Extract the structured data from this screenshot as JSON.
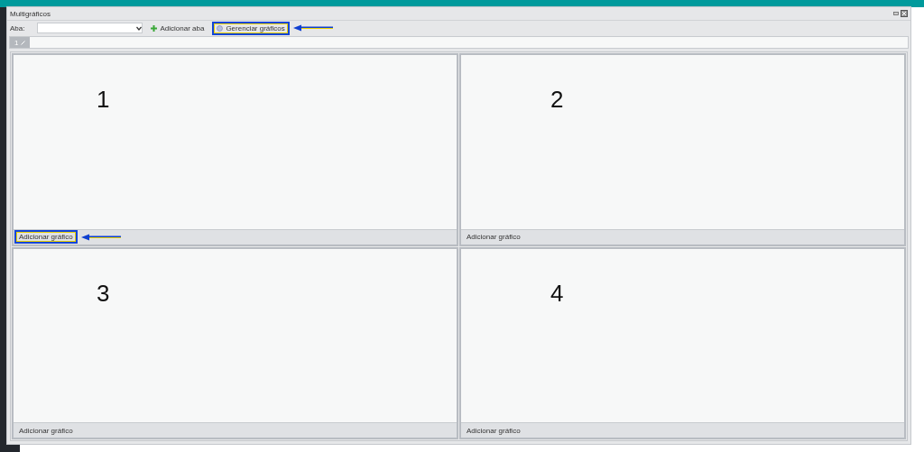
{
  "window": {
    "title": "Multigráficos"
  },
  "toolbar": {
    "tab_label": "Aba:",
    "add_tab_button": "Adicionar aba",
    "manage_button": {
      "label": "Gerenciar gráficos",
      "highlighted": true
    }
  },
  "tabs": [
    {
      "label": "1",
      "selected": true
    }
  ],
  "panels": [
    {
      "number": "1",
      "button": "Adicionar gráfico",
      "highlighted": true
    },
    {
      "number": "2",
      "button": "Adicionar gráfico",
      "highlighted": false
    },
    {
      "number": "3",
      "button": "Adicionar gráfico",
      "highlighted": false
    },
    {
      "number": "4",
      "button": "Adicionar gráfico",
      "highlighted": false
    }
  ]
}
